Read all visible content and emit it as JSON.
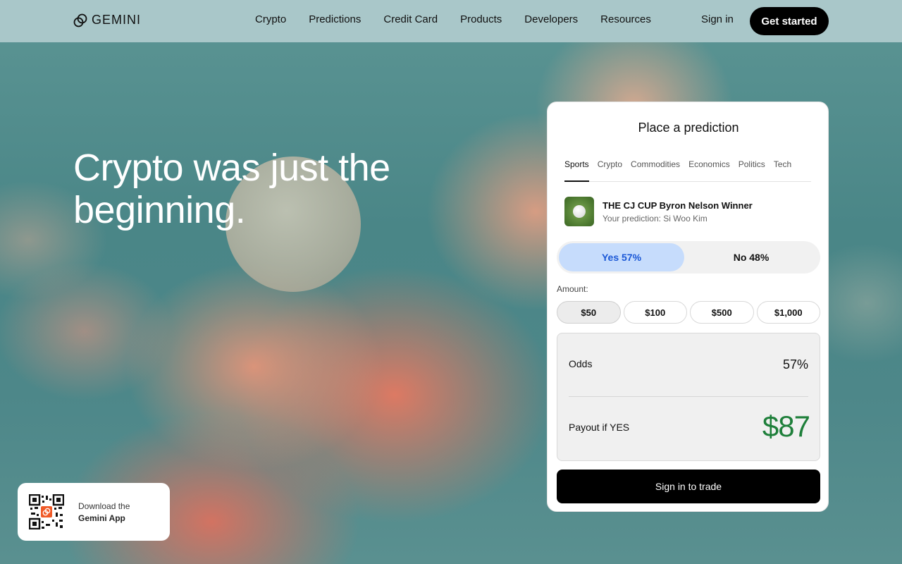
{
  "brand": {
    "name": "GEMINI",
    "logo_icon": "gemini-logo-icon"
  },
  "nav": {
    "links": [
      "Crypto",
      "Predictions",
      "Credit Card",
      "Products",
      "Developers",
      "Resources"
    ],
    "sign_in": "Sign in",
    "get_started": "Get started"
  },
  "hero": {
    "headline_line1": "Crypto was just the",
    "headline_line2": "beginning."
  },
  "prediction_card": {
    "title": "Place a prediction",
    "tabs": [
      "Sports",
      "Crypto",
      "Commodities",
      "Economics",
      "Politics",
      "Tech"
    ],
    "active_tab": "Sports",
    "event_title": "THE CJ CUP Byron Nelson Winner",
    "event_subtitle": "Your prediction: Si Woo Kim",
    "yes_label": "Yes 57%",
    "no_label": "No 48%",
    "amount_label": "Amount:",
    "amounts": [
      "$50",
      "$100",
      "$500",
      "$1,000"
    ],
    "selected_amount": "$50",
    "odds_label": "Odds",
    "odds_value": "57%",
    "payout_label": "Payout if YES",
    "payout_value": "$87",
    "trade_button": "Sign in to trade"
  },
  "download_app": {
    "line1": "Download the",
    "line2": "Gemini App",
    "qr_icon": "qr-code-icon"
  },
  "colors": {
    "nav_bg": "#a9c7c9",
    "yes_bg": "#c6dcfc",
    "yes_text": "#1a57d6",
    "payout_green": "#1e7f3a",
    "qr_accent": "#f05a28"
  }
}
